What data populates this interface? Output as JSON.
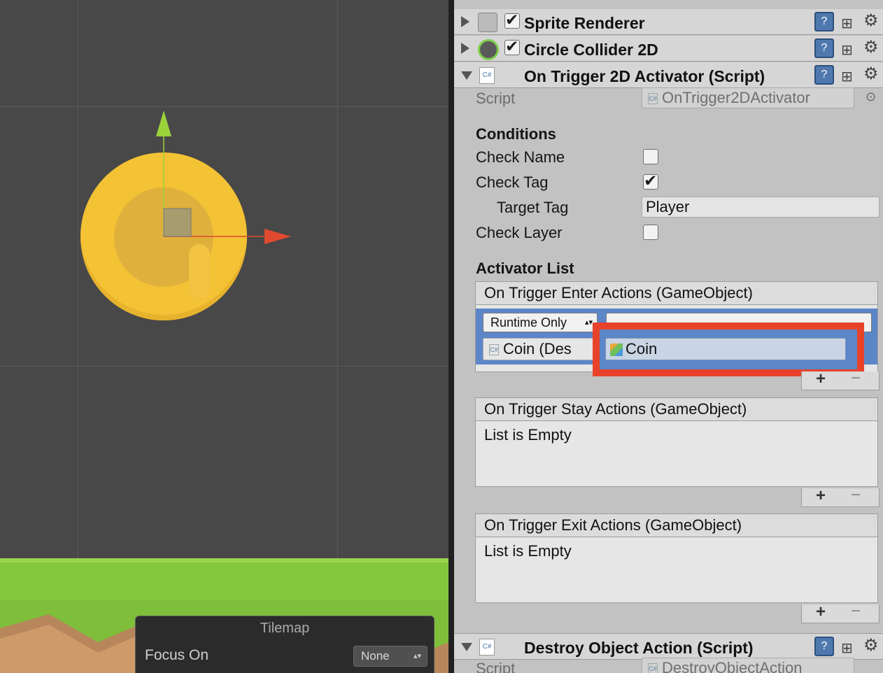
{
  "inspector": {
    "sprite_renderer": "Sprite Renderer",
    "circle_collider": "Circle Collider 2D",
    "trigger_activator": "On Trigger 2D Activator (Script)",
    "destroy_action": "Destroy Object Action (Script)",
    "script_label": "Script",
    "script_value_activator": "OnTrigger2DActivator",
    "script_value_destroy": "DestroyObjectAction",
    "conditions_header": "Conditions",
    "check_name": "Check Name",
    "check_tag": "Check Tag",
    "target_tag": "Target Tag",
    "target_tag_value": "Player",
    "check_layer": "Check Layer",
    "activator_list_header": "Activator List",
    "enter_list": "On Trigger Enter Actions (GameObject)",
    "stay_list": "On Trigger Stay Actions (GameObject)",
    "exit_list": "On Trigger Exit Actions (GameObject)",
    "list_empty": "List is Empty",
    "runtime_only": "Runtime Only",
    "event_target": "Coin (Des",
    "event_object": "Coin",
    "help_glyph": "?",
    "slider_glyph": "⊞",
    "gear_glyph": "⚙",
    "plus": "+",
    "minus": "−",
    "cs": "C#"
  },
  "tilemap": {
    "title": "Tilemap",
    "focus_label": "Focus On",
    "focus_value": "None"
  },
  "colors": {
    "highlight_box": "#e8432a",
    "selected_row": "#5b86c8",
    "coin": "#f4c235"
  }
}
